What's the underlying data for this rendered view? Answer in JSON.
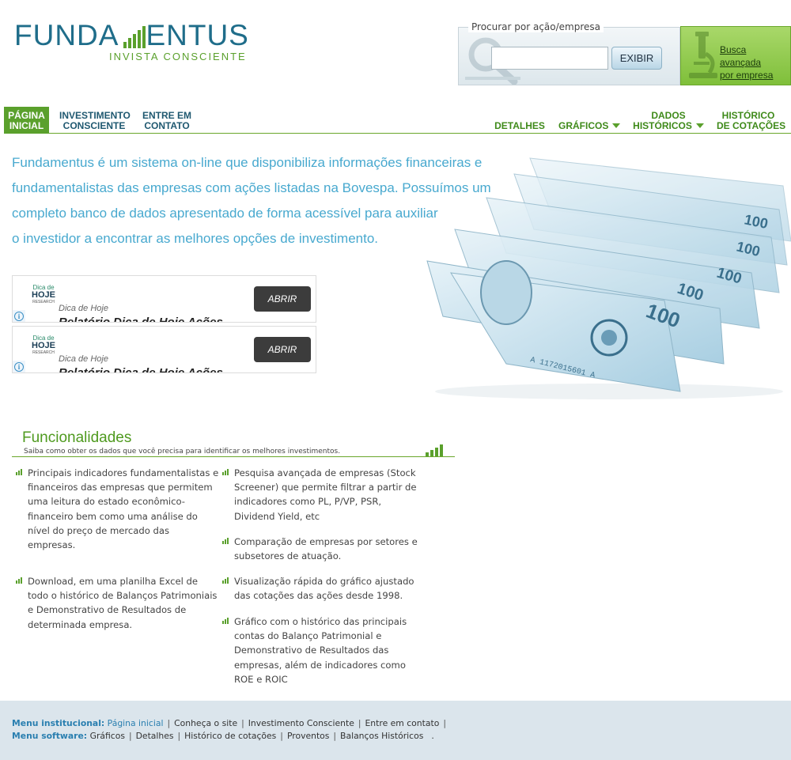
{
  "logo": {
    "name_before": "FUNDA",
    "name_after": "ENTUS",
    "tagline": "INVISTA CONSCIENTE"
  },
  "search": {
    "legend": "Procurar por ação/empresa",
    "value": "",
    "button_label": "EXIBIR"
  },
  "advanced_search": {
    "line1": "Busca avançada",
    "line2": "por empresa"
  },
  "nav": {
    "left": [
      {
        "line1": "PÁGINA",
        "line2": "INICIAL",
        "active": true
      },
      {
        "line1": "INVESTIMENTO",
        "line2": "CONSCIENTE"
      },
      {
        "line1": "ENTRE EM",
        "line2": "CONTATO"
      }
    ],
    "right": [
      {
        "line1": "DETALHES",
        "line2": ""
      },
      {
        "line1": "GRÁFICOS",
        "line2": ""
      },
      {
        "line1": "DADOS",
        "line2": "HISTÓRICOS"
      },
      {
        "line1": "HISTÓRICO",
        "line2": "DE COTAÇÕES"
      }
    ]
  },
  "intro": {
    "lines": [
      "Fundamentus é um sistema on-line que disponibiliza informações financeiras e",
      "fundamentalistas das empresas com ações listadas na Bovespa. Possuímos um",
      "completo banco de dados apresentado de forma acessível para auxiliar",
      "o investidor a encontrar as melhores opções de investimento."
    ]
  },
  "ads": [
    {
      "logo_top": "Dica de",
      "logo_big": "HOJE",
      "logo_small": "RESEARCH",
      "subtitle": "Dica de Hoje",
      "title": "Relatório Dica de Hoje Ações",
      "button": "ABRIR",
      "info": "i"
    },
    {
      "logo_top": "Dica de",
      "logo_big": "HOJE",
      "logo_small": "RESEARCH",
      "subtitle": "Dica de Hoje",
      "title": "Relatório Dica de Hoje Ações",
      "button": "ABRIR",
      "info": "i"
    }
  ],
  "funcionalidades": {
    "title": "Funcionalidades",
    "subtitle": "Saiba como obter os dados que você precisa para identificar os melhores investimentos.",
    "left": [
      {
        "lines": [
          "Principais indicadores fundamentalistas e",
          "financeiros das empresas que permitem",
          "uma leitura do estado econômico-",
          "financeiro bem como uma análise do",
          "nível do preço de mercado das",
          "empresas."
        ]
      },
      {
        "lines": [
          "Download, em uma planilha Excel de",
          "todo o histórico de Balanços Patrimoniais",
          "e Demonstrativo de Resultados de",
          "determinada empresa."
        ]
      }
    ],
    "right": [
      {
        "lines": [
          "Pesquisa avançada de empresas (Stock",
          "Screener) que permite filtrar a partir de",
          "indicadores como PL, P/VP, PSR,",
          "Dividend Yield, etc"
        ]
      },
      {
        "lines": [
          "Comparação de empresas por setores e",
          "subsetores de atuação."
        ]
      },
      {
        "lines": [
          "Visualização rápida do gráfico ajustado",
          "das cotações das ações desde 1998."
        ]
      },
      {
        "lines": [
          "Gráfico com o histórico das principais",
          "contas do Balanço Patrimonial e",
          "Demonstrativo de Resultados das",
          "empresas, além de indicadores como",
          "ROE e ROIC"
        ]
      }
    ]
  },
  "footer": {
    "institutional_label": "Menu institucional:",
    "institutional": [
      "Página inicial",
      "Conheça o site",
      "Investimento Consciente",
      "Entre em contato"
    ],
    "software_label": "Menu software:",
    "software": [
      "Gráficos",
      "Detalhes",
      "Histórico de cotações",
      "Proventos",
      "Balanços Históricos"
    ],
    "trailing": "."
  },
  "colors": {
    "brand_blue": "#1f6d8a",
    "brand_green": "#5aa02c",
    "intro_text": "#48a9cf",
    "footer_bg": "#dbe5ec"
  },
  "icons": [
    "logo-bars-icon",
    "magnifier-icon",
    "microscope-icon",
    "caret-down-icon",
    "info-icon",
    "bullet-bars-icon"
  ]
}
